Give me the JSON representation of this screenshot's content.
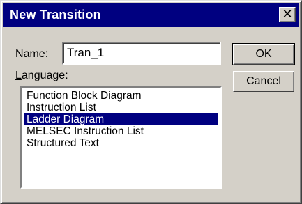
{
  "window": {
    "title": "New Transition",
    "close_glyph": "✕"
  },
  "form": {
    "name_label": "Name:",
    "name_value": "Tran_1",
    "language_label": "Language:"
  },
  "buttons": {
    "ok_label": "OK",
    "cancel_label": "Cancel"
  },
  "language_list": {
    "items": [
      {
        "label": "Function Block Diagram",
        "selected": false
      },
      {
        "label": "Instruction List",
        "selected": false
      },
      {
        "label": "Ladder Diagram",
        "selected": true
      },
      {
        "label": "MELSEC Instruction List",
        "selected": false
      },
      {
        "label": "Structured Text",
        "selected": false
      }
    ]
  },
  "colors": {
    "titlebar": "#000080",
    "selection": "#000080",
    "face": "#d4d0c8"
  }
}
